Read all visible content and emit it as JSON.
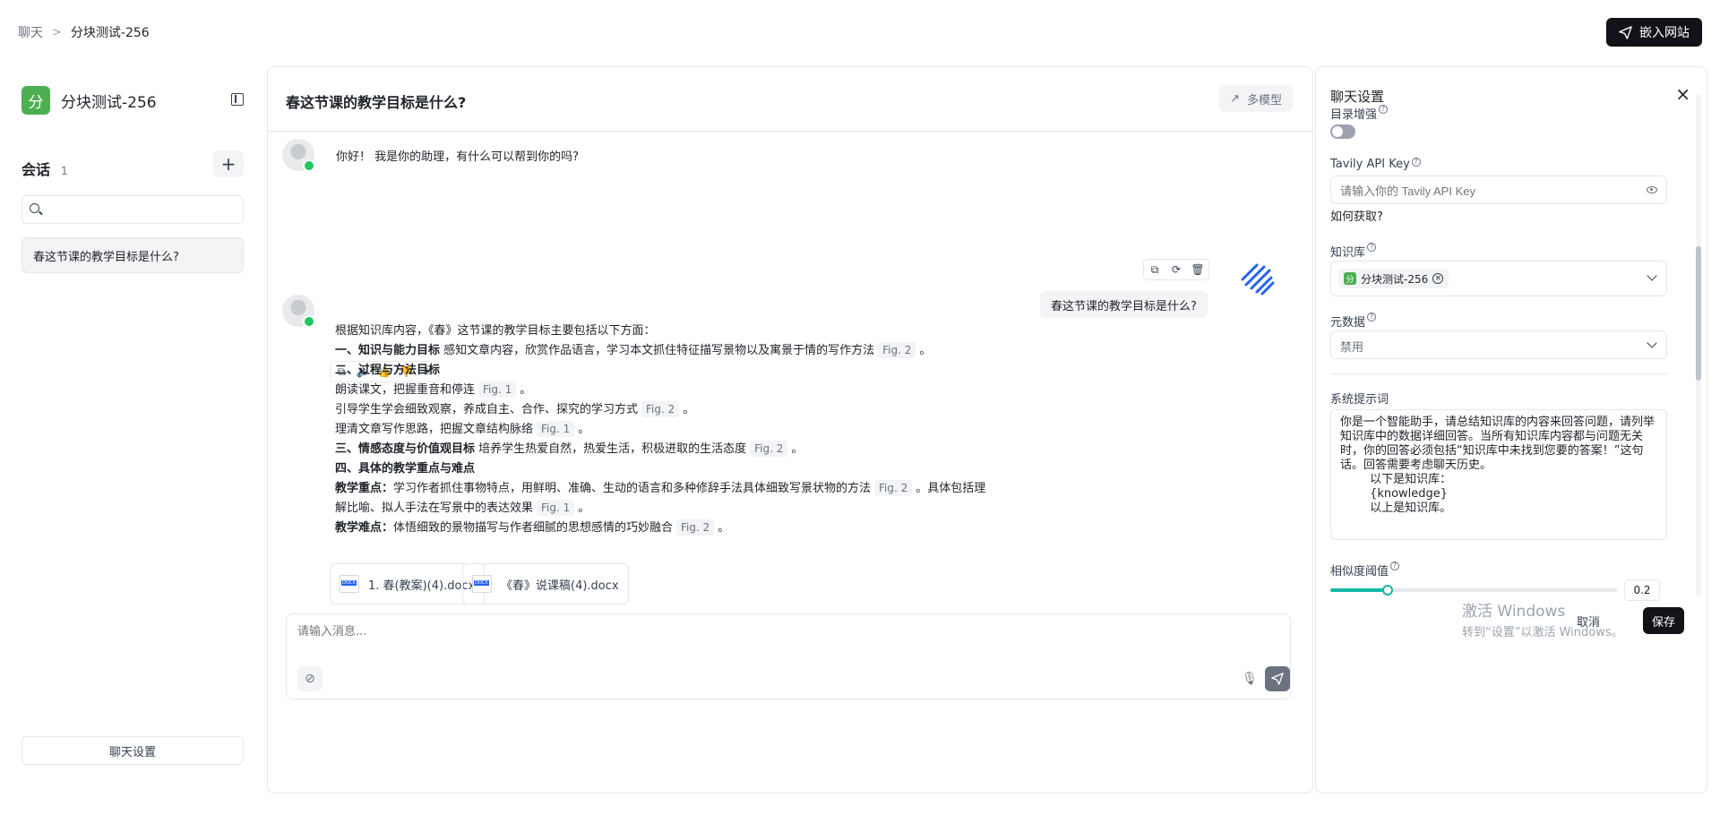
{
  "breadcrumb": {
    "root": "聊天",
    "separator": ">",
    "current": "分块测试-256"
  },
  "header": {
    "embed_label": "嵌入网站"
  },
  "sidebar": {
    "app_logo": "分",
    "app_name": "分块测试-256",
    "sessions_title": "会话",
    "sessions_count": "1",
    "add_label": "+",
    "search_placeholder": "",
    "items": [
      {
        "label": "春这节课的教学目标是什么?"
      }
    ],
    "chat_settings_label": "聊天设置"
  },
  "chat": {
    "title": "春这节课的教学目标是什么?",
    "multi_model_label": "多模型",
    "greeting": "你好！ 我是你的助理，有什么可以帮到你的吗?",
    "user_question": "春这节课的教学目标是什么?",
    "answer_lines": [
      {
        "bold": "",
        "text": "根据知识库内容，《春》这节课的教学目标主要包括以下方面：",
        "fig": ""
      },
      {
        "bold": "一、知识与能力目标",
        "text": " 感知文章内容，欣赏作品语言，学习本文抓住特征描写景物以及寓景于情的写作方法",
        "fig": "Fig. 2",
        "end": "。"
      },
      {
        "bold": "二、过程与方法目标",
        "text": "",
        "fig": ""
      },
      {
        "bold": "",
        "text": "朗读课文，把握重音和停连",
        "fig": "Fig. 1",
        "end": "。"
      },
      {
        "bold": "",
        "text": "引导学生学会细致观察，养成自主、合作、探究的学习方式",
        "fig": "Fig. 2",
        "end": "。"
      },
      {
        "bold": "",
        "text": "理清文章写作思路，把握文章结构脉络",
        "fig": "Fig. 1",
        "end": "。"
      },
      {
        "bold": "三、情感态度与价值观目标",
        "text": " 培养学生热爱自然，热爱生活，积极进取的生活态度",
        "fig": "Fig. 2",
        "end": "。"
      },
      {
        "bold": "四、具体的教学重点与难点",
        "text": "",
        "fig": ""
      },
      {
        "bold": "教学重点：",
        "text": "学习作者抓住事物特点，用鲜明、准确、生动的语言和多种修辞手法具体细致写景状物的方法",
        "fig": "Fig. 2",
        "end": "。具体包括理"
      },
      {
        "bold": "",
        "text": "解比喻、拟人手法在写景中的表达效果",
        "fig": "Fig. 1",
        "end": "。"
      },
      {
        "bold": "教学难点：",
        "text": "体悟细致的景物描写与作者细腻的思想感情的巧妙融合",
        "fig": "Fig. 2",
        "end": "。"
      }
    ],
    "docs": [
      {
        "name": "1. 春(教案)(4).docx"
      },
      {
        "name": "《春》说课稿(4).docx"
      }
    ],
    "input_placeholder": "请输入消息..."
  },
  "settings": {
    "title": "聊天设置",
    "toc_label": "目录增强",
    "toc_enabled": false,
    "tavily_label": "Tavily API Key",
    "tavily_placeholder": "请输入你的 Tavily API Key",
    "how_to_get": "如何获取?",
    "kb_label": "知识库",
    "kb_tag_logo": "分",
    "kb_tag": "分块测试-256",
    "metadata_label": "元数据",
    "metadata_value": "禁用",
    "prompt_label": "系统提示词",
    "prompt_text": "你是一个智能助手，请总结知识库的内容来回答问题，请列举知识库中的数据详细回答。当所有知识库内容都与问题无关时，你的回答必须包括“知识库中未找到您要的答案！”这句话。回答需要考虑聊天历史。\n        以下是知识库：\n        {knowledge}\n        以上是知识库。",
    "similarity_label": "相似度阈值",
    "similarity_value": "0.2",
    "similarity_fraction": 0.2,
    "cancel_label": "取消",
    "save_label": "保存"
  },
  "watermark": {
    "line1": "激活 Windows",
    "line2": "转到“设置”以激活 Windows。"
  },
  "colors": {
    "accent": "#14b8a6",
    "brand_dark": "#111318",
    "app_green": "#4caf50",
    "online": "#22c55e"
  }
}
